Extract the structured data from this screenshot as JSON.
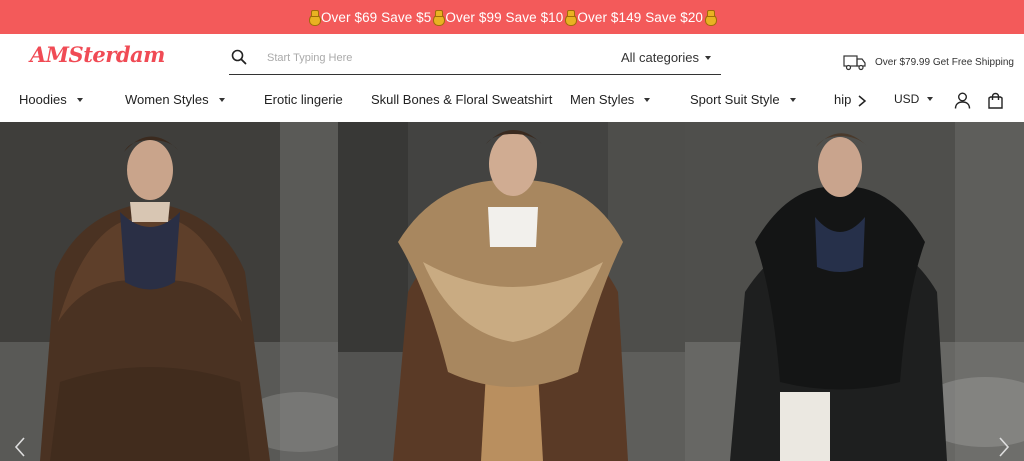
{
  "promo": {
    "offers": [
      "Over $69 Save $5",
      "Over $99 Save $10",
      "Over $149 Save $20"
    ],
    "icon": "money-bag-icon"
  },
  "header": {
    "logo": "AMSterdam",
    "search": {
      "placeholder": "Start Typing Here",
      "category": "All categories"
    },
    "shipping": "Over $79.99 Get Free Shipping"
  },
  "nav": {
    "items": [
      {
        "label": "Hoodies",
        "dropdown": true
      },
      {
        "label": "Women Styles",
        "dropdown": true
      },
      {
        "label": "Erotic lingerie",
        "dropdown": false
      },
      {
        "label": "Skull Bones & Floral Sweatshirt",
        "dropdown": false
      },
      {
        "label": "Men Styles",
        "dropdown": true
      },
      {
        "label": "Sport Suit Style",
        "dropdown": true
      },
      {
        "label": "hip",
        "dropdown": false
      }
    ],
    "currency": "USD"
  },
  "hero": {
    "slides": [
      "fur-coat-model-brown",
      "fur-coat-model-tan",
      "fur-coat-model-black"
    ]
  },
  "colors": {
    "accent": "#f35a5a",
    "logo": "#f04b55"
  }
}
